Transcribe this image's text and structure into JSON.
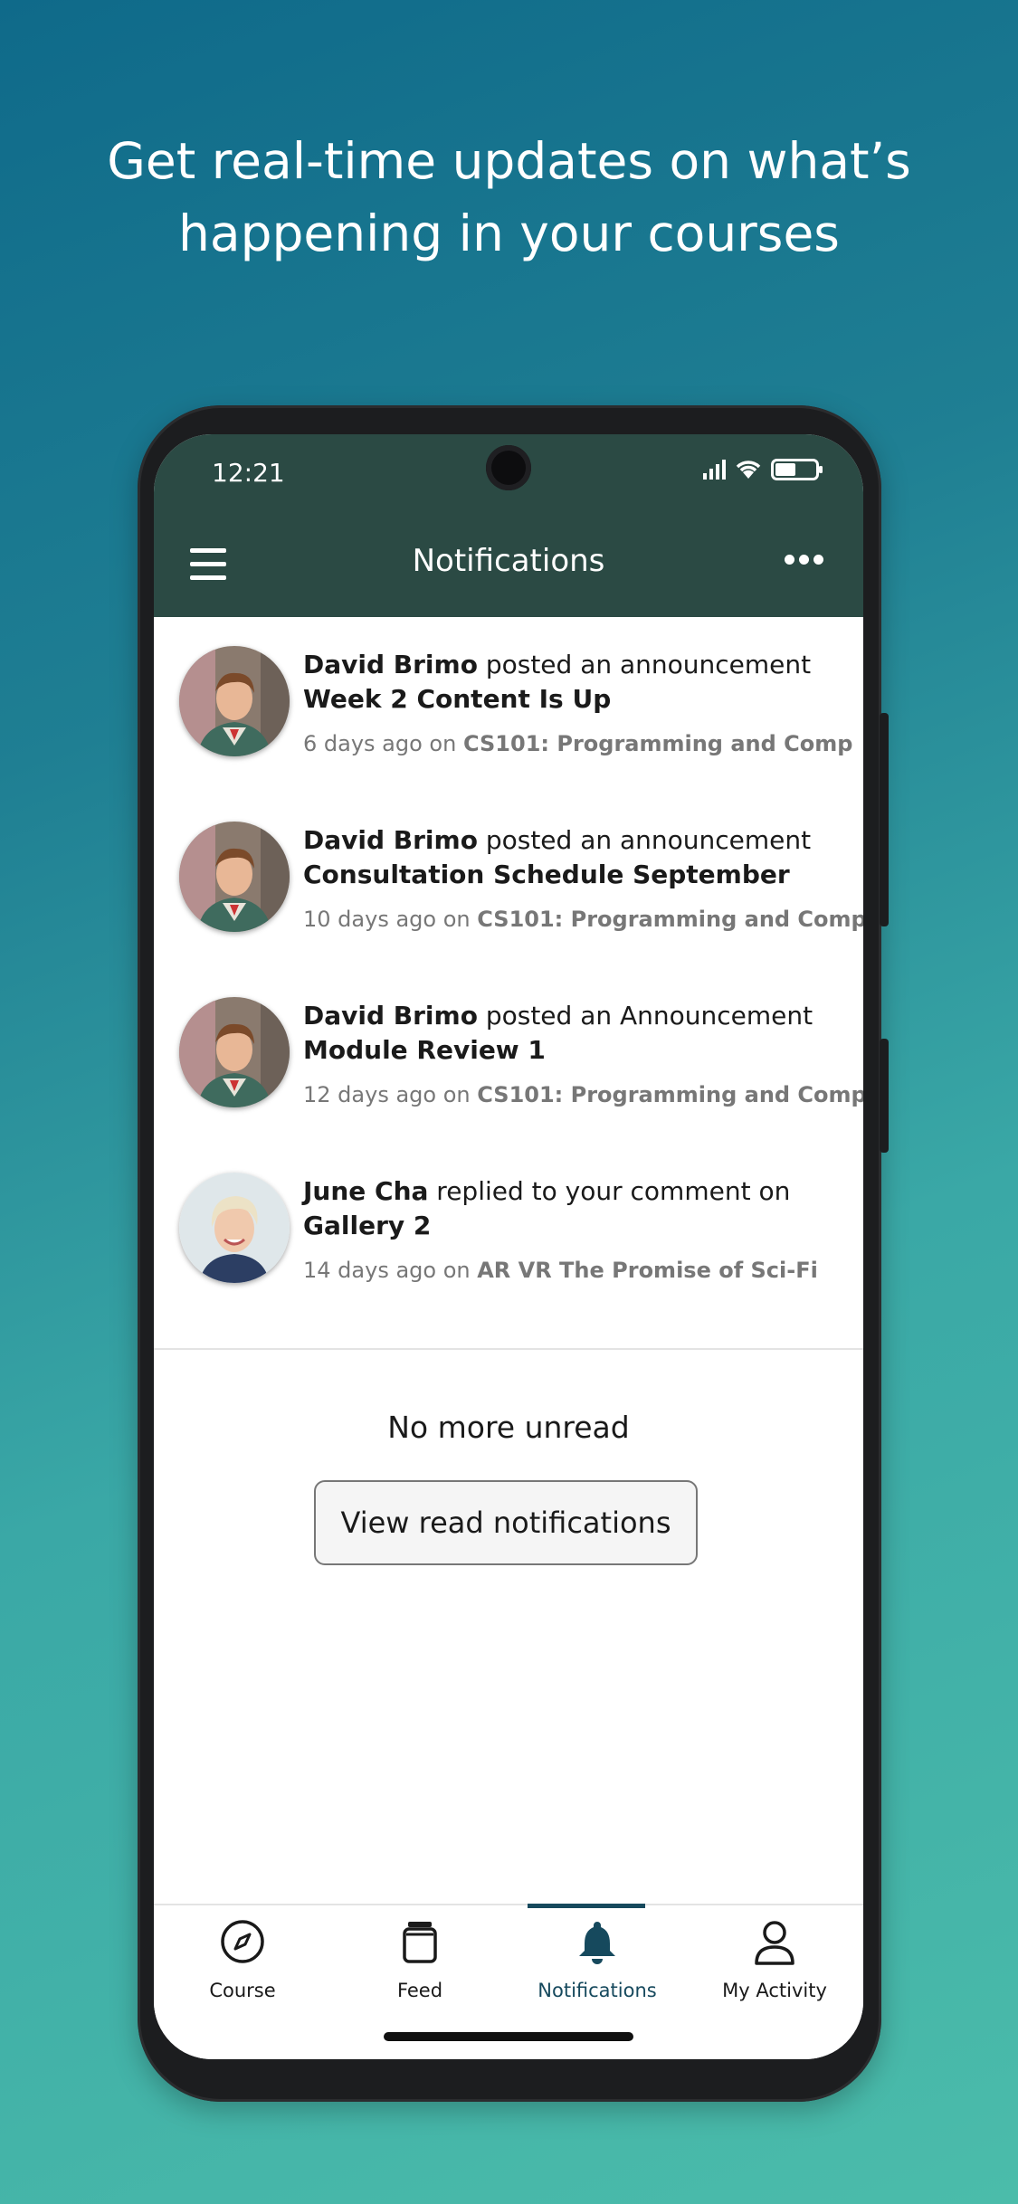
{
  "headline": {
    "line1": "Get real-time updates on what’s",
    "line2": "happening in your courses"
  },
  "status_bar": {
    "time": "12:21"
  },
  "app_bar": {
    "title": "Notifications",
    "menu_icon": "hamburger-icon",
    "more_icon": "more-horizontal-icon"
  },
  "notifications": [
    {
      "avatar": "male-avatar",
      "author": "David Brimo",
      "action": " posted an announcement",
      "subject": "Week 2 Content Is Up",
      "time": "6 days ago on ",
      "course": "CS101: Programming and Comp"
    },
    {
      "avatar": "male-avatar",
      "author": "David Brimo",
      "action": " posted an announcement",
      "subject": "Consultation Schedule September",
      "time": "10 days ago on ",
      "course": "CS101: Programming and Comp"
    },
    {
      "avatar": "male-avatar",
      "author": "David Brimo",
      "action": " posted an Announcement",
      "subject": "Module Review 1",
      "time": "12 days ago on ",
      "course": "CS101: Programming and Comp"
    },
    {
      "avatar": "female-avatar",
      "author": "June Cha",
      "action": " replied to your comment on",
      "subject": "Gallery 2",
      "time": "14 days ago on ",
      "course": "AR VR The Promise of Sci-Fi"
    }
  ],
  "empty_state": {
    "message": "No more unread",
    "button": "View read notifications"
  },
  "tabs": [
    {
      "label": "Course",
      "icon": "compass-icon"
    },
    {
      "label": "Feed",
      "icon": "feed-icon"
    },
    {
      "label": "Notifications",
      "icon": "bell-icon",
      "active": true
    },
    {
      "label": "My Activity",
      "icon": "person-icon"
    }
  ],
  "colors": {
    "app_bar": "#2b4a44",
    "active_tab": "#16495d"
  }
}
